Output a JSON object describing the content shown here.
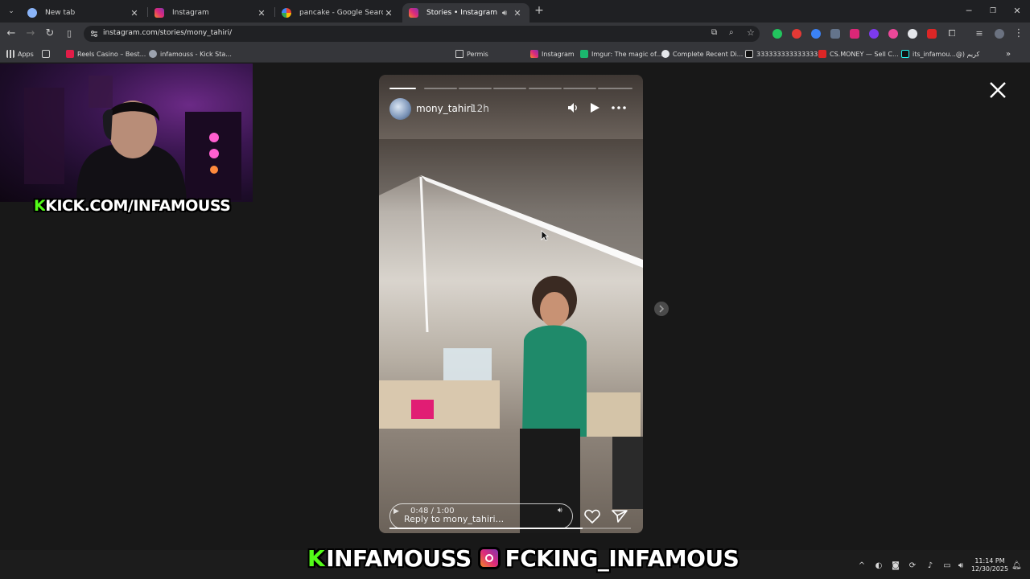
{
  "tabs": [
    {
      "label": "New tab",
      "icon": "chrome-icon"
    },
    {
      "label": "Instagram",
      "icon": "instagram-icon"
    },
    {
      "label": "pancake - Google Search",
      "icon": "google-icon"
    },
    {
      "label": "Stories • Instagram",
      "icon": "instagram-icon",
      "active": true
    }
  ],
  "address": {
    "url": "instagram.com/stories/mony_tahiri/"
  },
  "bookmarks": [
    {
      "label": "Apps"
    },
    {
      "label": "Reels Casino – Best..."
    },
    {
      "label": "infamouss - Kick Sta..."
    },
    {
      "label": "Permis"
    },
    {
      "label": "Instagram"
    },
    {
      "label": "Imgur: The magic of..."
    },
    {
      "label": "Complete Recent Di..."
    },
    {
      "label": "3333333333333333"
    },
    {
      "label": "CS.MONEY — Sell C..."
    },
    {
      "label": "its_infamou...@) كريم"
    }
  ],
  "story": {
    "username": "mony_tahiri",
    "time": "12h",
    "video_time": "0:48 / 1:00",
    "reply_placeholder": "Reply to mony_tahiri...",
    "progress_segments": 7,
    "current_segment_fraction": 0.8,
    "video_progress_fraction": 0.8
  },
  "overlay": {
    "kick_handle": "KICK.COM/INFAMOUSS",
    "kick_letter": "K",
    "bottom_kick": "INFAMOUSS",
    "bottom_instagram": "FCKING_INFAMOUS"
  },
  "taskbar": {
    "clock_time": "11:14 PM",
    "clock_date": "12/30/2025"
  },
  "colors": {
    "kick_green": "#53fc18",
    "instagram_gradient": [
      "#f58529",
      "#dd2a7b",
      "#8134af"
    ],
    "browser_dark": "#35363a"
  }
}
